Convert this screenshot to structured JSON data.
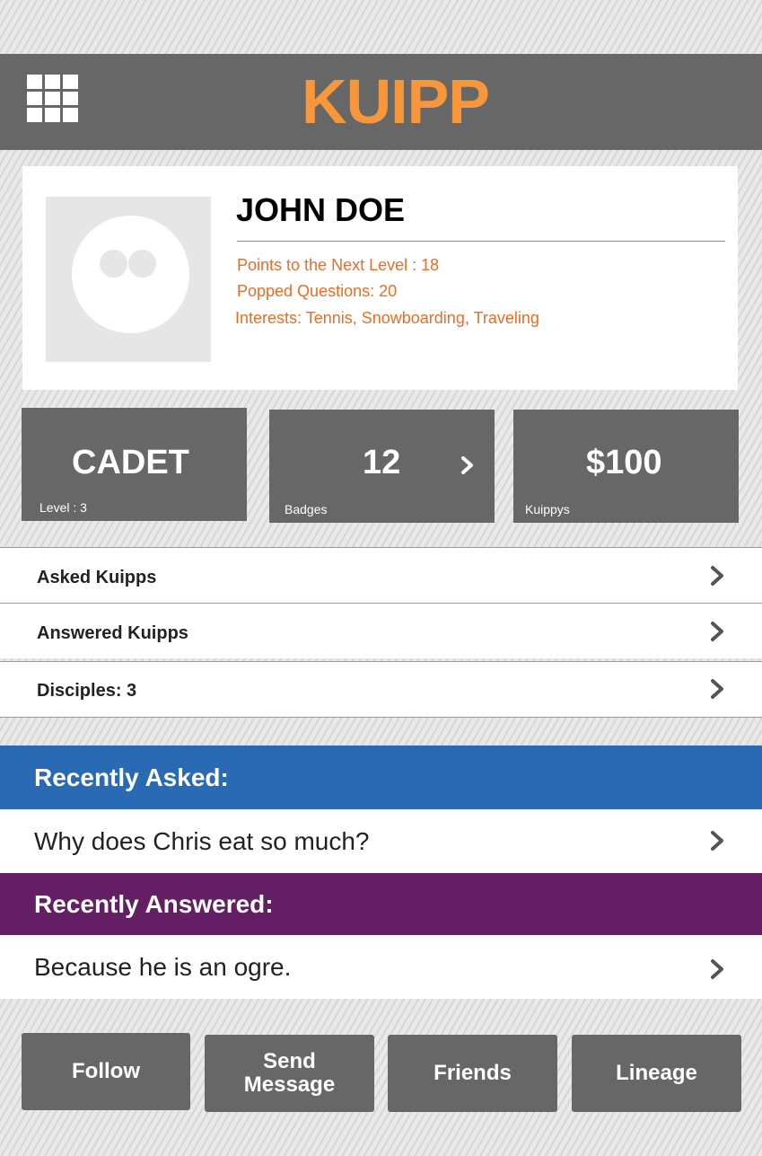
{
  "header": {
    "app_title": "KUIPP",
    "menu_icon": "grid-menu-icon",
    "title_color": "#f7963a",
    "bar_color": "#676767"
  },
  "profile": {
    "name": "JOHN DOE",
    "avatar_icon": "avatar-placeholder-icon",
    "points_line": "Points to the Next Level : 18",
    "popped_line": "Popped Questions: 20",
    "interests_line": "Interests: Tennis, Snowboarding, Traveling",
    "info_color": "#f26a21"
  },
  "stats": {
    "level": {
      "value": "CADET",
      "caption": "Level : 3"
    },
    "badges": {
      "value": "12",
      "caption": "Badges",
      "icon": "chevron-right-icon"
    },
    "kuippys": {
      "value": "$100",
      "caption": "Kuippys"
    }
  },
  "links": [
    {
      "label": "Asked Kuipps",
      "icon": "chevron-right-icon"
    },
    {
      "label": "Answered Kuipps",
      "icon": "chevron-right-icon"
    },
    {
      "label": "Disciples: 3",
      "icon": "chevron-right-icon"
    }
  ],
  "recently_asked": {
    "header": "Recently Asked:",
    "item": "Why does Chris eat so much?",
    "color": "#2a69b4"
  },
  "recently_answered": {
    "header": "Recently Answered:",
    "item": "Because he is an ogre.",
    "color": "#631e64"
  },
  "actions": {
    "follow": "Follow",
    "send_message_line1": "Send",
    "send_message_line2": "Message",
    "friends": "Friends",
    "lineage": "Lineage"
  }
}
